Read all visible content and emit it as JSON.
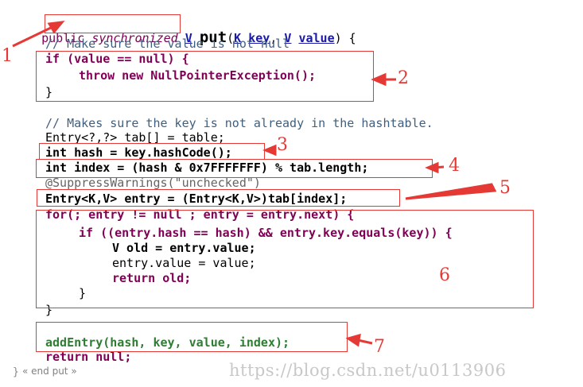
{
  "code": {
    "signature": {
      "public": "public",
      "synchronized": "synchronized",
      "ret": "V",
      "method": "put",
      "paren_open": "(",
      "k_type": "K",
      "k_name": "key",
      "comma": ",",
      "v_type": "V",
      "v_name": "value",
      "paren_close": ") {"
    },
    "line_comment1": "// Make sure the value is not null",
    "if_value_null": "if (value == null) {",
    "throw_npe": "throw new NullPointerException();",
    "close_brace": "}",
    "line_comment2": "// Makes sure the key is not already in the hashtable.",
    "entry_tab": "Entry<?,?> tab[] = table;",
    "int_hash": "int hash = key.hashCode();",
    "int_index": "int index = (hash & 0x7FFFFFFF) % tab.length;",
    "suppress": "@SuppressWarnings(\"unchecked\")",
    "entry_cast": "Entry<K,V> entry = (Entry<K,V>)tab[index];",
    "for_loop": "for(; entry != null ; entry = entry.next) {",
    "if_equals": "if ((entry.hash == hash) && entry.key.equals(key)) {",
    "v_old": "V old = entry.value;",
    "entry_value": "entry.value = value;",
    "return_old": "return old;",
    "inner_close": "}",
    "for_close": "}",
    "add_entry": "addEntry(hash, key, value, index);",
    "return_null": "return null;",
    "method_close": "}",
    "end_put": "« end put »"
  },
  "markers": {
    "m1": "1",
    "m2": "2",
    "m3": "3",
    "m4": "4",
    "m5": "5",
    "m6": "6",
    "m7": "7"
  },
  "watermark": "https://blog.csdn.net/u0113906",
  "colors": {
    "annotation_red": "#e53935",
    "keyword": "#7f0055",
    "comment": "#3f5f7f",
    "number": "#c00000"
  }
}
